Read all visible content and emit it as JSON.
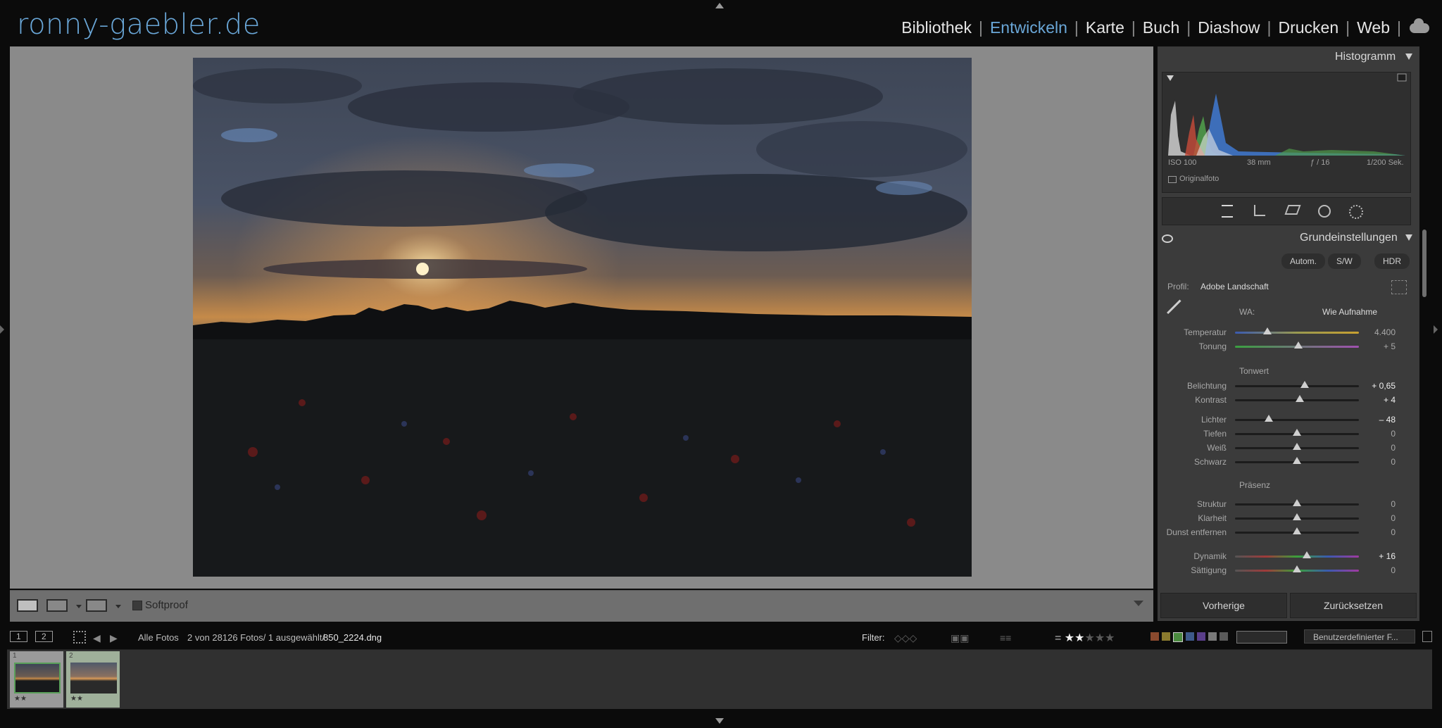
{
  "brand": "ronny-gaebler.de",
  "modules": [
    "Bibliothek",
    "Entwickeln",
    "Karte",
    "Buch",
    "Diashow",
    "Drucken",
    "Web"
  ],
  "active_module": "Entwickeln",
  "toolbar": {
    "softproof": "Softproof"
  },
  "histogram": {
    "title": "Histogramm",
    "iso": "ISO 100",
    "focal": "38 mm",
    "aperture": "ƒ / 16",
    "shutter": "1/200 Sek.",
    "original": "Originalfoto"
  },
  "basic": {
    "title": "Grundeinstellungen",
    "buttons": [
      "Autom.",
      "S/W",
      "HDR"
    ],
    "profile_label": "Profil:",
    "profile_value": "Adobe Landschaft",
    "wb_label": "WA:",
    "wb_value": "Wie Aufnahme",
    "tone_header": "Tonwert",
    "presence_header": "Präsenz",
    "sliders": [
      {
        "label": "Temperatur",
        "value": "4.400",
        "pos": 0.26,
        "highlight": false
      },
      {
        "label": "Tonung",
        "value": "+ 5",
        "pos": 0.51,
        "highlight": false
      },
      {
        "label": "Belichtung",
        "value": "+ 0,65",
        "pos": 0.56,
        "highlight": true
      },
      {
        "label": "Kontrast",
        "value": "+ 4",
        "pos": 0.52,
        "highlight": true
      },
      {
        "label": "Lichter",
        "value": "– 48",
        "pos": 0.27,
        "highlight": true
      },
      {
        "label": "Tiefen",
        "value": "0",
        "pos": 0.5,
        "highlight": false
      },
      {
        "label": "Weiß",
        "value": "0",
        "pos": 0.5,
        "highlight": false
      },
      {
        "label": "Schwarz",
        "value": "0",
        "pos": 0.5,
        "highlight": false
      },
      {
        "label": "Struktur",
        "value": "0",
        "pos": 0.5,
        "highlight": false
      },
      {
        "label": "Klarheit",
        "value": "0",
        "pos": 0.5,
        "highlight": false
      },
      {
        "label": "Dunst entfernen",
        "value": "0",
        "pos": 0.5,
        "highlight": false
      },
      {
        "label": "Dynamik",
        "value": "+ 16",
        "pos": 0.58,
        "highlight": true
      },
      {
        "label": "Sättigung",
        "value": "0",
        "pos": 0.5,
        "highlight": false
      }
    ],
    "previous": "Vorherige",
    "reset": "Zurücksetzen"
  },
  "filmstrip": {
    "view1": "1",
    "view2": "2",
    "source": "Alle Fotos",
    "count": "2 von 28126 Fotos/ 1 ausgewählt/",
    "filename": "850_2224.dng",
    "filter_label": "Filter:",
    "preset": "Benutzerdefinierter F...",
    "thumbs": [
      {
        "number": "1",
        "stars": "★★"
      },
      {
        "number": "2",
        "stars": "★★"
      }
    ],
    "rating_filled": 2,
    "rating_total": 5
  },
  "colors": {
    "accent": "#6aa7d8",
    "panel": "#3b3b3b",
    "canvas": "#8a8a8a"
  }
}
